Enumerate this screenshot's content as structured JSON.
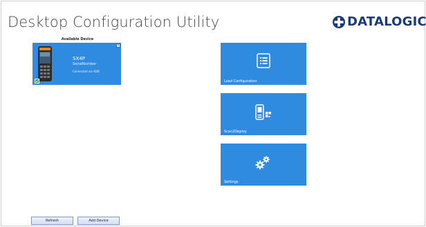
{
  "app": {
    "title": "Desktop Configuration Utility",
    "brand": "DATALOGIC"
  },
  "devices": {
    "heading": "Available Device",
    "items": [
      {
        "name": "SX4P",
        "serial": "SerialNumber",
        "connection": "Connected via ADB"
      }
    ]
  },
  "tiles": [
    {
      "label": "Load Configuration",
      "icon": "list-document-icon"
    },
    {
      "label": "Scan2Deploy",
      "icon": "phone-qr-icon"
    },
    {
      "label": "Settings",
      "icon": "gears-icon"
    }
  ],
  "buttons": {
    "refresh": "Refresh",
    "add_device": "Add Device"
  },
  "colors": {
    "tile": "#2f8be0",
    "brand": "#1b3a78",
    "check": "#3a9d3a"
  }
}
